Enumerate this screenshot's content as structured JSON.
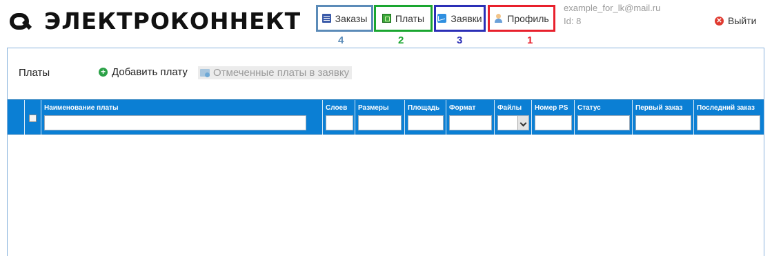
{
  "header": {
    "logo_text": "ЭЛЕКТРОКОННЕКТ",
    "nav": {
      "orders": "Заказы",
      "boards": "Платы",
      "requests": "Заявки",
      "profile": "Профиль"
    },
    "annotations": {
      "orders": "4",
      "boards": "2",
      "requests": "3",
      "profile": "1"
    },
    "annotation_colors": {
      "orders": "#5b8bb8",
      "boards": "#1aa630",
      "requests": "#2b2fb6",
      "profile": "#e8202c"
    },
    "user_email": "example_for_lk@mail.ru",
    "user_id": "Id: 8",
    "logout": "Выйти"
  },
  "main": {
    "title": "Платы",
    "add_button": "Добавить плату",
    "marked_button": "Отмеченные платы в заявку",
    "grid_color": "#0b7fd4",
    "columns": [
      "Наименование платы",
      "Слоев",
      "Размеры",
      "Площадь",
      "Формат",
      "Файлы",
      "Номер PS",
      "Статус",
      "Первый заказ",
      "Последний заказ"
    ]
  }
}
